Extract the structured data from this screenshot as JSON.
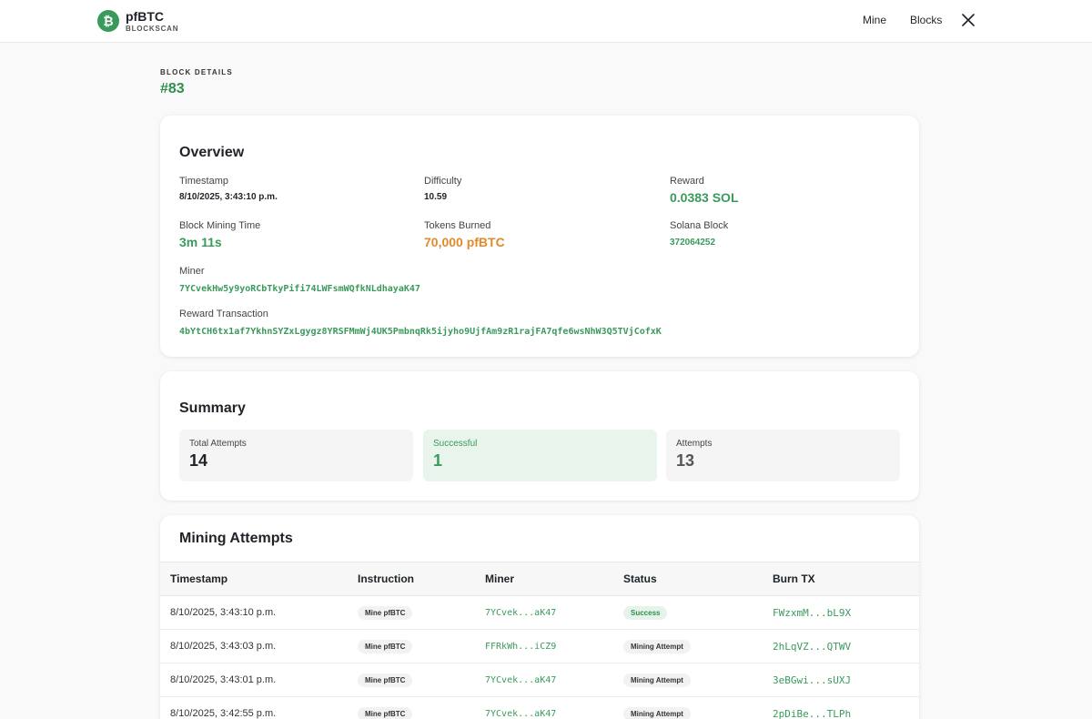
{
  "header": {
    "brand_name": "pfBTC",
    "brand_sub": "BLOCKSCAN",
    "logo_glyph": "₿",
    "nav": [
      {
        "label": "Mine"
      },
      {
        "label": "Blocks"
      }
    ],
    "x_icon": "x-social-icon"
  },
  "page": {
    "eyebrow": "BLOCK DETAILS",
    "title": "#83"
  },
  "overview": {
    "title": "Overview",
    "timestamp": {
      "label": "Timestamp",
      "value": "8/10/2025, 3:43:10 p.m."
    },
    "difficulty": {
      "label": "Difficulty",
      "value": "10.59"
    },
    "reward": {
      "label": "Reward",
      "value": "0.0383 SOL"
    },
    "mining_time": {
      "label": "Block Mining Time",
      "value": "3m 11s"
    },
    "tokens_burned": {
      "label": "Tokens Burned",
      "value": "70,000 pfBTC"
    },
    "solana_block": {
      "label": "Solana Block",
      "value": "372064252"
    },
    "miner": {
      "label": "Miner",
      "value": "7YCvekHw5y9yoRCbTkyPifi74LWFsmWQfkNLdhayaK47"
    },
    "reward_tx": {
      "label": "Reward Transaction",
      "value": "4bYtCH6tx1af7YkhnSYZxLgygz8YRSFMmWj4UK5PmbnqRk5ijyho9UjfAm9zR1rajFA7qfe6wsNhW3Q5TVjCofxK"
    }
  },
  "summary": {
    "title": "Summary",
    "stats": [
      {
        "label": "Total Attempts",
        "value": "14"
      },
      {
        "label": "Successful",
        "value": "1"
      },
      {
        "label": "Attempts",
        "value": "13"
      }
    ]
  },
  "attempts": {
    "title": "Mining Attempts",
    "columns": [
      "Timestamp",
      "Instruction",
      "Miner",
      "Status",
      "Burn TX"
    ],
    "rows": [
      {
        "timestamp": "8/10/2025, 3:43:10 p.m.",
        "instruction": "Mine pfBTC",
        "miner": "7YCvek...aK47",
        "status": "Success",
        "burn_tx": "FWzxmM...bL9X"
      },
      {
        "timestamp": "8/10/2025, 3:43:03 p.m.",
        "instruction": "Mine pfBTC",
        "miner": "FFRkWh...iCZ9",
        "status": "Mining Attempt",
        "burn_tx": "2hLqVZ...QTWV"
      },
      {
        "timestamp": "8/10/2025, 3:43:01 p.m.",
        "instruction": "Mine pfBTC",
        "miner": "7YCvek...aK47",
        "status": "Mining Attempt",
        "burn_tx": "3eBGwi...sUXJ"
      },
      {
        "timestamp": "8/10/2025, 3:42:55 p.m.",
        "instruction": "Mine pfBTC",
        "miner": "7YCvek...aK47",
        "status": "Mining Attempt",
        "burn_tx": "2pDiBe...TLPh"
      }
    ]
  },
  "colors": {
    "brand_green": "#3a9a5b",
    "accent_orange": "#e08a2c"
  }
}
